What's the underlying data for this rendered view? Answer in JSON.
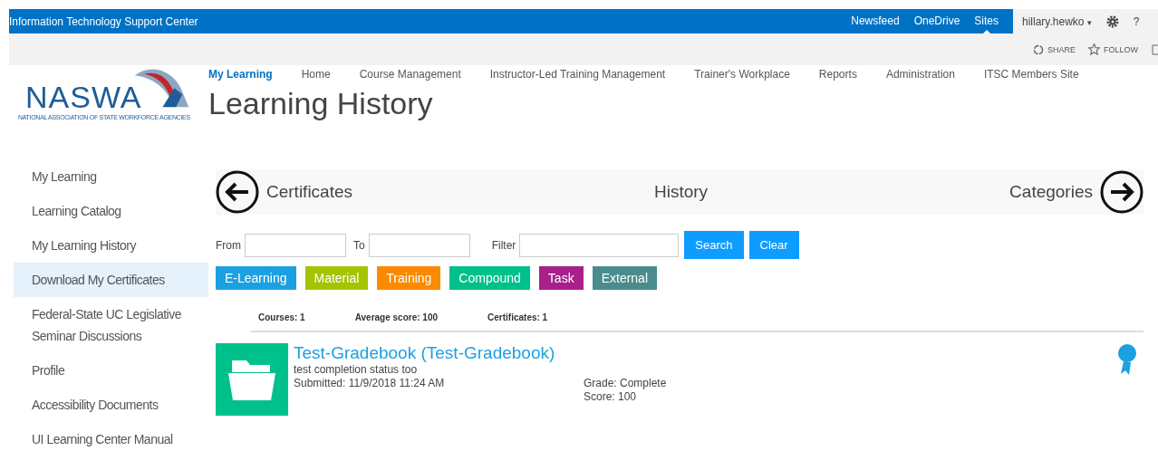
{
  "suite_bar": {
    "title": "Information Technology Support Center",
    "links": [
      {
        "label": "Newsfeed",
        "selected": false
      },
      {
        "label": "OneDrive",
        "selected": false
      },
      {
        "label": "Sites",
        "selected": true
      }
    ],
    "user": "hillary.hewko",
    "user_caret": "▾",
    "help": "?"
  },
  "ribbon": {
    "actions": [
      "SHARE",
      "FOLLOW"
    ]
  },
  "logo": {
    "name": "NASWA",
    "subtitle": "NATIONAL ASSOCIATION OF STATE WORKFORCE AGENCIES"
  },
  "top_nav": [
    {
      "label": "My Learning",
      "selected": true
    },
    {
      "label": "Home",
      "selected": false
    },
    {
      "label": "Course Management",
      "selected": false
    },
    {
      "label": "Instructor-Led Training Management",
      "selected": false
    },
    {
      "label": "Trainer's Workplace",
      "selected": false
    },
    {
      "label": "Reports",
      "selected": false
    },
    {
      "label": "Administration",
      "selected": false
    },
    {
      "label": "ITSC Members Site",
      "selected": false
    }
  ],
  "page_title": "Learning History",
  "sidebar": {
    "items": [
      {
        "label": "My Learning",
        "selected": false
      },
      {
        "label": "Learning Catalog",
        "selected": false
      },
      {
        "label": "My Learning History",
        "selected": false
      },
      {
        "label": "Download My Certificates",
        "selected": true
      },
      {
        "label": "Federal-State UC Legislative Seminar Discussions",
        "selected": false
      },
      {
        "label": "Profile",
        "selected": false
      },
      {
        "label": "Accessibility Documents",
        "selected": false
      },
      {
        "label": "UI Learning Center Manual",
        "selected": false
      }
    ]
  },
  "section_nav": {
    "previous": "Certificates",
    "current": "History",
    "next": "Categories"
  },
  "filters": {
    "from_label": "From",
    "to_label": "To",
    "filter_label": "Filter",
    "buttons": [
      "Search",
      "Clear"
    ]
  },
  "type_tags": [
    {
      "label": "E-Learning",
      "color": "#1ba1e2"
    },
    {
      "label": "Material",
      "color": "#a4c400"
    },
    {
      "label": "Training",
      "color": "#fa8a00"
    },
    {
      "label": "Compound",
      "color": "#00c08b"
    },
    {
      "label": "Task",
      "color": "#a8208a"
    },
    {
      "label": "External",
      "color": "#4a8c8c"
    }
  ],
  "stats": [
    "Courses: 1",
    "Average score: 100",
    "Certificates: 1"
  ],
  "history_items": [
    {
      "title": "Test-Gradebook (Test-Gradebook)",
      "description": "test completion status too",
      "submitted": "Submitted: 11/9/2018 11:24 AM",
      "grade": "Grade: Complete",
      "score": "Score: 100",
      "certificate": true
    }
  ]
}
